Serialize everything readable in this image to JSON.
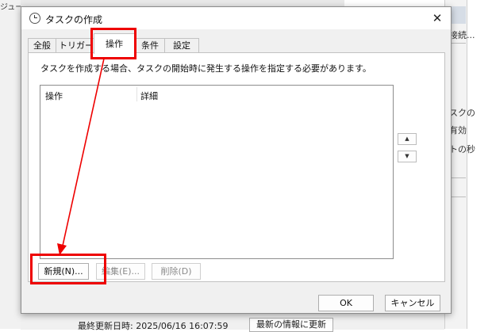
{
  "background": {
    "left_title": "ジューラ ライブラリ",
    "right_texts": [
      "接続...",
      "スクの",
      "有効",
      "トの秒"
    ],
    "status_text": "最終更新日時: 2025/06/16 16:07:59",
    "refresh_button": "最新の情報に更新"
  },
  "dialog": {
    "title": "タスクの作成",
    "close_glyph": "✕",
    "tabs": [
      "全般",
      "トリガー",
      "操作",
      "条件",
      "設定"
    ],
    "active_tab": "操作",
    "description": "タスクを作成する場合、タスクの開始時に発生する操作を指定する必要があります。",
    "columns": [
      "操作",
      "詳細"
    ],
    "move_up_glyph": "▲",
    "move_down_glyph": "▼",
    "buttons": {
      "new": "新規(N)...",
      "edit": "編集(E)...",
      "delete": "削除(D)",
      "ok": "OK",
      "cancel": "キャンセル"
    }
  },
  "annotations": {
    "color": "#ee0000"
  }
}
